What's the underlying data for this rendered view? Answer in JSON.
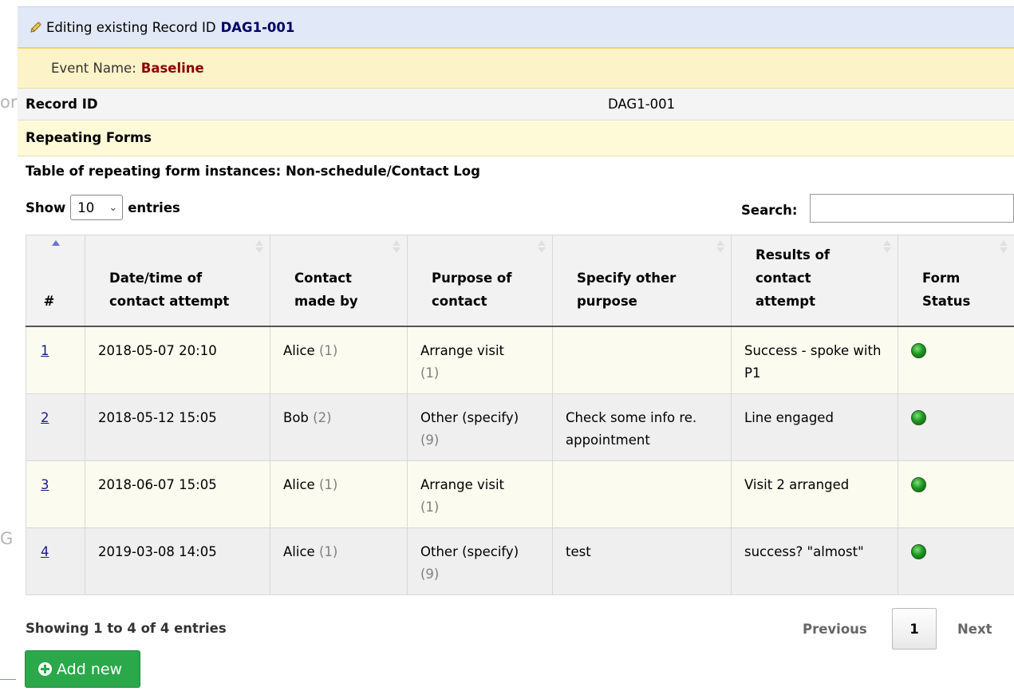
{
  "edge_fragments": {
    "top": "or",
    "middle": "G"
  },
  "header": {
    "edit_prefix": "Editing existing Record ID",
    "record_id": "DAG1-001",
    "pencil_icon": "pencil-icon",
    "event_label": "Event Name:",
    "event_name": "Baseline"
  },
  "record_row": {
    "label": "Record ID",
    "value": "DAG1-001"
  },
  "repeating": {
    "section_label": "Repeating Forms",
    "table_title": "Table of repeating form instances: Non-schedule/Contact Log"
  },
  "controls": {
    "show_label": "Show",
    "page_size": "10",
    "entries_label": "entries",
    "search_label": "Search:",
    "search_value": ""
  },
  "table": {
    "columns": [
      [
        "#"
      ],
      [
        "Date/time of",
        "contact attempt"
      ],
      [
        "Contact",
        "made by"
      ],
      [
        "Purpose of",
        "contact"
      ],
      [
        "Specify other",
        "purpose"
      ],
      [
        "Results of",
        "contact",
        "attempt"
      ],
      [
        "Form",
        "Status"
      ]
    ],
    "rows": [
      {
        "num": "1",
        "datetime": "2018-05-07 20:10",
        "by": "Alice",
        "by_code": "(1)",
        "purpose": "Arrange visit",
        "purpose_code": "(1)",
        "other": "",
        "result": "Success - spoke with P1",
        "status": "complete"
      },
      {
        "num": "2",
        "datetime": "2018-05-12 15:05",
        "by": "Bob",
        "by_code": "(2)",
        "purpose": "Other (specify)",
        "purpose_code": "(9)",
        "other": "Check some info re. appointment",
        "result": "Line engaged",
        "status": "complete"
      },
      {
        "num": "3",
        "datetime": "2018-06-07 15:05",
        "by": "Alice",
        "by_code": "(1)",
        "purpose": "Arrange visit",
        "purpose_code": "(1)",
        "other": "",
        "result": "Visit 2 arranged",
        "status": "complete"
      },
      {
        "num": "4",
        "datetime": "2019-03-08 14:05",
        "by": "Alice",
        "by_code": "(1)",
        "purpose": "Other (specify)",
        "purpose_code": "(9)",
        "other": "test",
        "result": "success? \"almost\"",
        "status": "complete"
      }
    ]
  },
  "footer": {
    "showing": "Showing 1 to 4 of 4 entries",
    "previous": "Previous",
    "current_page": "1",
    "next": "Next",
    "add_new": "Add new"
  },
  "colors": {
    "edit_bar_bg": "#e1e8f7",
    "event_bar_bg": "#fdf3c8",
    "event_name": "#8b0000",
    "add_button": "#2aa84a",
    "status_complete": "#1f9a1f"
  }
}
